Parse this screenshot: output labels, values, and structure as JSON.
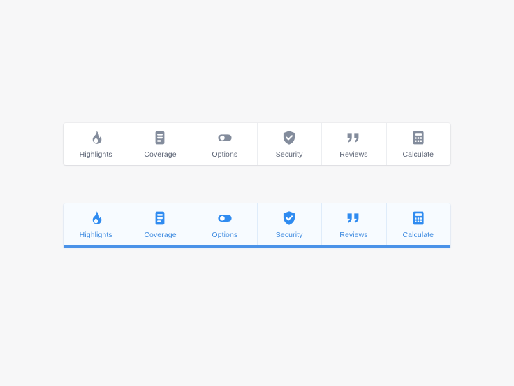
{
  "page": {
    "background_color": "#f7f7f8"
  },
  "toolbars": [
    {
      "id": "inactive",
      "state": "inactive",
      "icon_color": "#838c9c",
      "label_color": "#5c6475",
      "background": "#ffffff",
      "underline_color": "",
      "items": [
        {
          "label": "Highlights",
          "icon": "flame-icon"
        },
        {
          "label": "Coverage",
          "icon": "document-list-icon"
        },
        {
          "label": "Options",
          "icon": "toggle-switch-icon"
        },
        {
          "label": "Security",
          "icon": "shield-check-icon"
        },
        {
          "label": "Reviews",
          "icon": "quotation-marks-icon"
        },
        {
          "label": "Calculate",
          "icon": "calculator-icon"
        }
      ]
    },
    {
      "id": "active",
      "state": "active",
      "icon_color": "#2f8bf0",
      "label_color": "#3d8ae0",
      "background": "#f7fbff",
      "underline_color": "#4a92e8",
      "items": [
        {
          "label": "Highlights",
          "icon": "flame-icon"
        },
        {
          "label": "Coverage",
          "icon": "document-list-icon"
        },
        {
          "label": "Options",
          "icon": "toggle-switch-icon"
        },
        {
          "label": "Security",
          "icon": "shield-check-icon"
        },
        {
          "label": "Reviews",
          "icon": "quotation-marks-icon"
        },
        {
          "label": "Calculate",
          "icon": "calculator-icon"
        }
      ]
    }
  ]
}
